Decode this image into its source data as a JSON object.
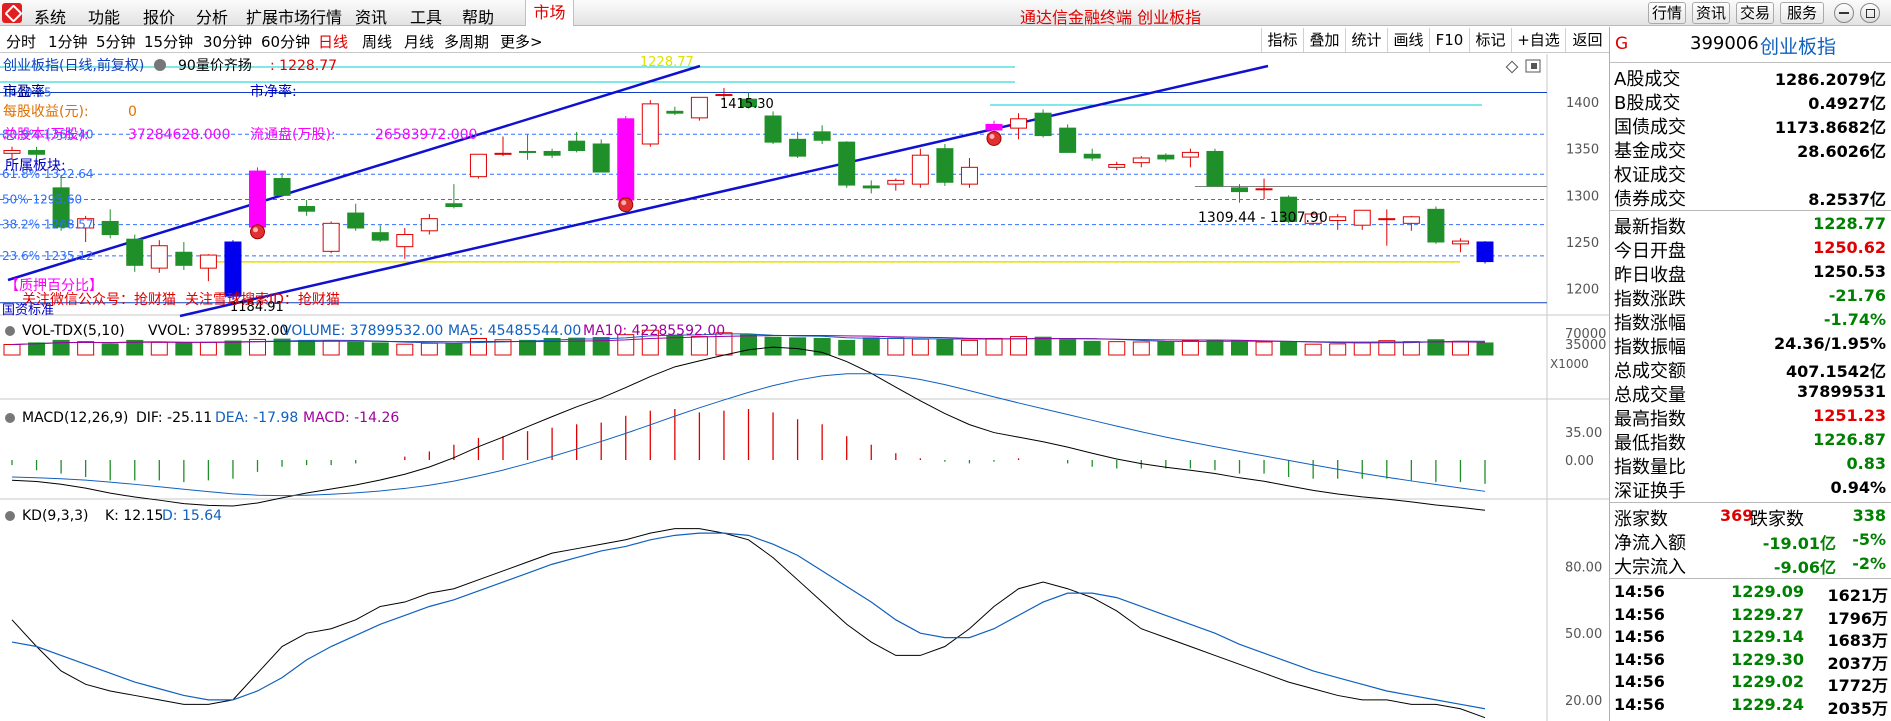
{
  "menubar": {
    "items": [
      "系统",
      "功能",
      "报价",
      "分析",
      "扩展市场行情",
      "资讯",
      "工具",
      "帮助"
    ],
    "market_tab": "市场",
    "title": "通达信金融终端  创业板指",
    "right_buttons": [
      "行情",
      "资讯",
      "交易",
      "服务"
    ]
  },
  "periodbar": {
    "periods": [
      "分时",
      "1分钟",
      "5分钟",
      "15分钟",
      "30分钟",
      "60分钟",
      "日线",
      "周线",
      "月线",
      "多周期",
      "更多>"
    ],
    "active": "日线",
    "tools": [
      "指标",
      "叠加",
      "统计",
      "画线",
      "F10",
      "标记",
      "+自选",
      "返回"
    ]
  },
  "main_chart": {
    "title": "创业板指(日线,前复权)",
    "indicator": "90量价齐扬",
    "indicator_value": ": 1228.77",
    "top_price": "1228.77",
    "high_label": "1415.30",
    "low_label": "1184.91",
    "range_label": "1309.44 - 1307.90",
    "price_axis": [
      "1400",
      "1350",
      "1300",
      "1250",
      "1200"
    ],
    "fib_labels": [
      "1410.15",
      "80.9% 1365.40",
      "61.8% 1322.64",
      "50% 1295.60",
      "38.2% 1268.57",
      "23.6% 1235.12"
    ],
    "info": {
      "pe_label": "市盈率",
      "pb_label": "市净率:",
      "eps_label": "每股收益(元):",
      "eps_value": "0",
      "total_shares_label": "总股本(万股):",
      "total_shares_value": "37284628.000",
      "float_shares_label": "流通盘(万股):",
      "float_shares_value": "26583972.000",
      "sector_label": "所属板块:",
      "pledge_label": "【质押百分比】",
      "wechat_note": "关注微信公众号：抢财猫",
      "xueqiu_note": "关注雪球搜索ID：抢财猫",
      "bottom_note": "国资标准"
    }
  },
  "vol_panel": {
    "title": "VOL-TDX(5,10)",
    "vvol": "VVOL: 37899532.00",
    "volume": "VOLUME: 37899532.00",
    "ma5": "MA5: 45485544.00",
    "ma10": "MA10: 42285592.00",
    "axis": [
      "70000",
      "35000"
    ],
    "unit": "X1000"
  },
  "macd_panel": {
    "title": "MACD(12,26,9)",
    "dif": "DIF: -25.11",
    "dea": "DEA: -17.98",
    "macd": "MACD: -14.26",
    "axis": [
      "35.00",
      "0.00"
    ]
  },
  "kd_panel": {
    "title": "KD(9,3,3)",
    "k": "K: 12.15",
    "d": "D: 15.64",
    "axis": [
      "80.00",
      "50.00",
      "20.00"
    ]
  },
  "colors": {
    "up": "#e00000",
    "down": "#1f8f2a",
    "channel": "#1010d0",
    "fib": "#3070ff",
    "magenta": "#ff00ff",
    "cyan": "#00d0d0",
    "yellow": "#e0e000"
  },
  "chart_data": {
    "type": "candlestick",
    "title": "创业板指(日线,前复权)",
    "ylim": [
      1175,
      1445
    ],
    "candles": [
      [
        1345,
        1352,
        1338,
        1348
      ],
      [
        1348,
        1352,
        1340,
        1344
      ],
      [
        1308,
        1322,
        1262,
        1266
      ],
      [
        1265,
        1278,
        1250,
        1275
      ],
      [
        1272,
        1285,
        1254,
        1258
      ],
      [
        1253,
        1258,
        1218,
        1225
      ],
      [
        1222,
        1252,
        1217,
        1246
      ],
      [
        1239,
        1250,
        1220,
        1225
      ],
      [
        1222,
        1237,
        1208,
        1236
      ],
      [
        1250,
        1252,
        1188,
        1192
      ],
      [
        1266,
        1330,
        1262,
        1326
      ],
      [
        1318,
        1324,
        1300,
        1300
      ],
      [
        1288,
        1295,
        1278,
        1283
      ],
      [
        1240,
        1272,
        1238,
        1270
      ],
      [
        1281,
        1291,
        1262,
        1265
      ],
      [
        1260,
        1268,
        1250,
        1252
      ],
      [
        1245,
        1265,
        1232,
        1258
      ],
      [
        1262,
        1280,
        1258,
        1275
      ],
      [
        1291,
        1312,
        1286,
        1288
      ],
      [
        1320,
        1337,
        1318,
        1344
      ],
      [
        1345,
        1363,
        1342,
        1345
      ],
      [
        1347,
        1365,
        1338,
        1346
      ],
      [
        1347,
        1350,
        1340,
        1343
      ],
      [
        1358,
        1368,
        1346,
        1348
      ],
      [
        1355,
        1360,
        1325,
        1325
      ],
      [
        1295,
        1385,
        1291,
        1382
      ],
      [
        1355,
        1402,
        1352,
        1398
      ],
      [
        1390,
        1395,
        1386,
        1388
      ],
      [
        1383,
        1405,
        1380,
        1405
      ],
      [
        1408,
        1415,
        1402,
        1408
      ],
      [
        1403,
        1410,
        1393,
        1395
      ],
      [
        1385,
        1390,
        1355,
        1357
      ],
      [
        1360,
        1368,
        1340,
        1342
      ],
      [
        1368,
        1375,
        1355,
        1359
      ],
      [
        1357,
        1358,
        1308,
        1311
      ],
      [
        1310,
        1316,
        1302,
        1308
      ],
      [
        1312,
        1318,
        1305,
        1316
      ],
      [
        1312,
        1350,
        1308,
        1343
      ],
      [
        1350,
        1355,
        1310,
        1314
      ],
      [
        1312,
        1340,
        1308,
        1330
      ],
      [
        1370,
        1380,
        1362,
        1376
      ],
      [
        1372,
        1388,
        1360,
        1382
      ],
      [
        1388,
        1392,
        1362,
        1364
      ],
      [
        1372,
        1376,
        1346,
        1346
      ],
      [
        1344,
        1350,
        1337,
        1340
      ],
      [
        1330,
        1336,
        1327,
        1333
      ],
      [
        1335,
        1342,
        1330,
        1340
      ],
      [
        1343,
        1345,
        1336,
        1339
      ],
      [
        1341,
        1350,
        1330,
        1346
      ],
      [
        1347,
        1350,
        1310,
        1310
      ],
      [
        1308,
        1312,
        1292,
        1304
      ],
      [
        1307,
        1318,
        1296,
        1307
      ],
      [
        1298,
        1300,
        1270,
        1272
      ],
      [
        1270,
        1282,
        1268,
        1280
      ],
      [
        1273,
        1280,
        1263,
        1277
      ],
      [
        1268,
        1284,
        1263,
        1284
      ],
      [
        1274,
        1285,
        1246,
        1275
      ],
      [
        1270,
        1278,
        1262,
        1277
      ],
      [
        1285,
        1288,
        1248,
        1250
      ],
      [
        1248,
        1254,
        1239,
        1251
      ],
      [
        1250,
        1251,
        1227,
        1229
      ]
    ],
    "volume": [
      33000,
      38000,
      46000,
      42000,
      35000,
      46000,
      40000,
      38000,
      40000,
      44000,
      49000,
      50000,
      46000,
      44000,
      40000,
      38000,
      34000,
      37000,
      35000,
      52000,
      48000,
      46000,
      52000,
      53000,
      55000,
      64000,
      78000,
      62000,
      58000,
      70000,
      64000,
      56000,
      54000,
      52000,
      46000,
      54000,
      53000,
      50000,
      48000,
      46000,
      52000,
      58000,
      56000,
      48000,
      43000,
      42000,
      41000,
      41000,
      45000,
      45000,
      44000,
      41000,
      40000,
      34000,
      35000,
      38000,
      45000,
      42000,
      48000,
      43000,
      37900
    ],
    "macd_hist": [
      -3,
      -6,
      -8,
      -10,
      -12,
      -12,
      -12,
      -13,
      -12,
      -11,
      -7,
      -4,
      -3,
      -3,
      -2,
      0,
      2,
      5,
      9,
      13,
      14,
      17,
      19,
      21,
      22,
      26,
      29,
      30,
      28,
      29,
      30,
      28,
      24,
      21,
      14,
      9,
      4,
      1,
      -1,
      -2,
      -1,
      1,
      0,
      -2,
      -4,
      -5,
      -5,
      -5,
      -5,
      -6,
      -8,
      -8,
      -10,
      -11,
      -11,
      -11,
      -11,
      -12,
      -13,
      -13,
      -14
    ],
    "kd": {
      "k": [
        56,
        44,
        33,
        27,
        24,
        22,
        20,
        18,
        18,
        20,
        32,
        44,
        50,
        52,
        56,
        62,
        64,
        68,
        70,
        74,
        78,
        82,
        86,
        88,
        90,
        92,
        95,
        97,
        97,
        95,
        92,
        84,
        74,
        64,
        54,
        46,
        40,
        40,
        44,
        52,
        62,
        70,
        73,
        70,
        66,
        60,
        52,
        48,
        44,
        40,
        36,
        32,
        28,
        25,
        22,
        20,
        20,
        18,
        18,
        16,
        12
      ],
      "d": [
        46,
        44,
        40,
        36,
        32,
        28,
        25,
        22,
        20,
        20,
        24,
        30,
        38,
        44,
        49,
        54,
        58,
        62,
        65,
        69,
        73,
        77,
        81,
        84,
        87,
        89,
        92,
        94,
        95,
        95,
        94,
        90,
        85,
        78,
        71,
        64,
        56,
        50,
        48,
        48,
        52,
        58,
        64,
        68,
        68,
        66,
        62,
        58,
        54,
        50,
        45,
        41,
        37,
        33,
        30,
        27,
        24,
        22,
        20,
        18,
        16
      ]
    }
  },
  "quote_panel": {
    "g": "G",
    "code": "399006",
    "name": "创业板指",
    "rows": [
      {
        "label": "A股成交",
        "value": "1286.2079亿",
        "color": "black"
      },
      {
        "label": "B股成交",
        "value": "0.4927亿",
        "color": "black"
      },
      {
        "label": "国债成交",
        "value": "1173.8682亿",
        "color": "black"
      },
      {
        "label": "基金成交",
        "value": "28.6026亿",
        "color": "black"
      },
      {
        "label": "权证成交",
        "value": "",
        "color": "black"
      },
      {
        "label": "债券成交",
        "value": "8.2537亿",
        "color": "black"
      }
    ],
    "rows2": [
      {
        "label": "最新指数",
        "value": "1228.77",
        "color": "green"
      },
      {
        "label": "今日开盘",
        "value": "1250.62",
        "color": "red"
      },
      {
        "label": "昨日收盘",
        "value": "1250.53",
        "color": "black"
      },
      {
        "label": "指数涨跌",
        "value": "-21.76",
        "color": "green"
      },
      {
        "label": "指数涨幅",
        "value": "-1.74%",
        "color": "green"
      },
      {
        "label": "指数振幅",
        "value": "24.36/1.95%",
        "color": "black"
      },
      {
        "label": "总成交额",
        "value": "407.1542亿",
        "color": "black"
      },
      {
        "label": "总成交量",
        "value": "37899531",
        "color": "black"
      },
      {
        "label": "最高指数",
        "value": "1251.23",
        "color": "red"
      },
      {
        "label": "最低指数",
        "value": "1226.87",
        "color": "green"
      },
      {
        "label": "指数量比",
        "value": "0.83",
        "color": "green"
      },
      {
        "label": "深证换手",
        "value": "0.94%",
        "color": "black"
      }
    ],
    "up_count_label": "涨家数",
    "up_count": "369",
    "down_count_label": "跌家数",
    "down_count": "338",
    "net_inflow_label": "净流入额",
    "net_inflow": "-19.01亿",
    "net_inflow_pct": "-5%",
    "block_inflow_label": "大宗流入",
    "block_inflow": "-9.06亿",
    "block_inflow_pct": "-2%",
    "ticks": [
      {
        "time": "14:56",
        "price": "1229.09",
        "vol": "1621万"
      },
      {
        "time": "14:56",
        "price": "1229.27",
        "vol": "1796万"
      },
      {
        "time": "14:56",
        "price": "1229.14",
        "vol": "1683万"
      },
      {
        "time": "14:56",
        "price": "1229.30",
        "vol": "2037万"
      },
      {
        "time": "14:56",
        "price": "1229.02",
        "vol": "1772万"
      },
      {
        "time": "14:56",
        "price": "1229.24",
        "vol": "2035万"
      }
    ]
  }
}
